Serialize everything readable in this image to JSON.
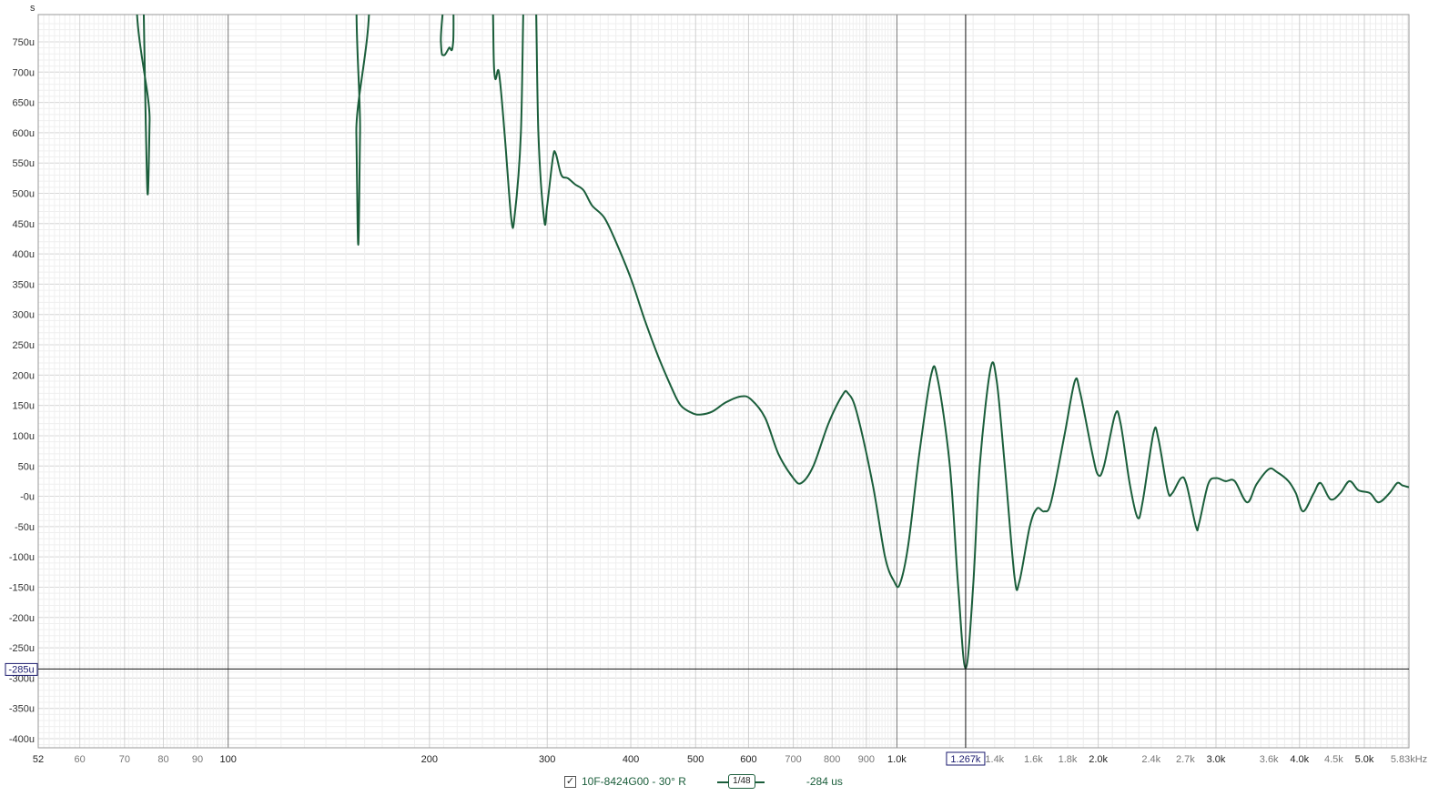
{
  "chart_data": {
    "type": "line",
    "yunit": "s",
    "xunit": "Hz",
    "xscale": "log",
    "xlim": [
      52,
      5830
    ],
    "ylim": [
      -0.000415,
      0.000795
    ],
    "y_ticks": [
      {
        "v": 0.00075,
        "label": "750u"
      },
      {
        "v": 0.0007,
        "label": "700u"
      },
      {
        "v": 0.00065,
        "label": "650u"
      },
      {
        "v": 0.0006,
        "label": "600u"
      },
      {
        "v": 0.00055,
        "label": "550u"
      },
      {
        "v": 0.0005,
        "label": "500u"
      },
      {
        "v": 0.00045,
        "label": "450u"
      },
      {
        "v": 0.0004,
        "label": "400u"
      },
      {
        "v": 0.00035,
        "label": "350u"
      },
      {
        "v": 0.0003,
        "label": "300u"
      },
      {
        "v": 0.00025,
        "label": "250u"
      },
      {
        "v": 0.0002,
        "label": "200u"
      },
      {
        "v": 0.00015,
        "label": "150u"
      },
      {
        "v": 0.0001,
        "label": "100u"
      },
      {
        "v": 5e-05,
        "label": "50u"
      },
      {
        "v": 0,
        "label": "-0u"
      },
      {
        "v": -5e-05,
        "label": "-50u"
      },
      {
        "v": -0.0001,
        "label": "-100u"
      },
      {
        "v": -0.00015,
        "label": "-150u"
      },
      {
        "v": -0.0002,
        "label": "-200u"
      },
      {
        "v": -0.00025,
        "label": "-250u"
      },
      {
        "v": -0.0003,
        "label": "-300u"
      },
      {
        "v": -0.00035,
        "label": "-350u"
      },
      {
        "v": -0.0004,
        "label": "-400u"
      }
    ],
    "x_ticks": [
      {
        "v": 52,
        "label": "52"
      },
      {
        "v": 60,
        "label": "60"
      },
      {
        "v": 70,
        "label": "70"
      },
      {
        "v": 80,
        "label": "80"
      },
      {
        "v": 90,
        "label": "90"
      },
      {
        "v": 100,
        "label": "100"
      },
      {
        "v": 200,
        "label": "200"
      },
      {
        "v": 300,
        "label": "300"
      },
      {
        "v": 400,
        "label": "400"
      },
      {
        "v": 500,
        "label": "500"
      },
      {
        "v": 600,
        "label": "600"
      },
      {
        "v": 700,
        "label": "700"
      },
      {
        "v": 800,
        "label": "800"
      },
      {
        "v": 900,
        "label": "900"
      },
      {
        "v": 1000,
        "label": "1.0k"
      },
      {
        "v": 1400,
        "label": "1.4k"
      },
      {
        "v": 1600,
        "label": "1.6k"
      },
      {
        "v": 1800,
        "label": "1.8k"
      },
      {
        "v": 2000,
        "label": "2.0k"
      },
      {
        "v": 2400,
        "label": "2.4k"
      },
      {
        "v": 2700,
        "label": "2.7k"
      },
      {
        "v": 3000,
        "label": "3.0k"
      },
      {
        "v": 3600,
        "label": "3.6k"
      },
      {
        "v": 4000,
        "label": "4.0k"
      },
      {
        "v": 4500,
        "label": "4.5k"
      },
      {
        "v": 5000,
        "label": "5.0k"
      },
      {
        "v": 5830,
        "label": "5.83kHz"
      }
    ],
    "cursor": {
      "x": 1267,
      "x_label": "1.267k",
      "y": -0.000285,
      "y_label": "-285u"
    },
    "series": [
      {
        "name": "10F-8424G00 - 30° R",
        "color": "#1b5e3b",
        "points": [
          [
            74.5,
            0.0009
          ],
          [
            75.3,
            0.00062
          ],
          [
            75.8,
            0.000498
          ],
          [
            76.3,
            0.00062
          ],
          [
            77.0,
            0.0009
          ],
          [
            154,
            0.0009
          ],
          [
            155.5,
            0.0006
          ],
          [
            156.5,
            0.000415
          ],
          [
            157.5,
            0.0006
          ],
          [
            159,
            0.0009
          ],
          [
            206,
            0.0009
          ],
          [
            208,
            0.00075
          ],
          [
            210,
            0.000728
          ],
          [
            214,
            0.00074
          ],
          [
            217,
            0.00075
          ],
          [
            220,
            0.0009
          ],
          [
            245,
            0.0009
          ],
          [
            250,
            0.0007
          ],
          [
            254,
            0.0007
          ],
          [
            259,
            0.0006
          ],
          [
            265,
            0.00046
          ],
          [
            268,
            0.00046
          ],
          [
            274,
            0.0006
          ],
          [
            278,
            0.0009
          ],
          [
            287,
            0.0009
          ],
          [
            291,
            0.0006
          ],
          [
            297,
            0.000455
          ],
          [
            300,
            0.00048
          ],
          [
            306,
            0.00056
          ],
          [
            309,
            0.000565
          ],
          [
            315,
            0.00053
          ],
          [
            322,
            0.000525
          ],
          [
            330,
            0.000515
          ],
          [
            340,
            0.000505
          ],
          [
            350,
            0.00048
          ],
          [
            365,
            0.00046
          ],
          [
            380,
            0.00042
          ],
          [
            400,
            0.00036
          ],
          [
            420,
            0.00029
          ],
          [
            440,
            0.00023
          ],
          [
            460,
            0.00018
          ],
          [
            475,
            0.00015
          ],
          [
            495,
            0.000137
          ],
          [
            510,
            0.000135
          ],
          [
            530,
            0.00014
          ],
          [
            555,
            0.000155
          ],
          [
            585,
            0.000165
          ],
          [
            605,
            0.00016
          ],
          [
            635,
            0.00013
          ],
          [
            665,
            7e-05
          ],
          [
            700,
            3e-05
          ],
          [
            720,
            2.2e-05
          ],
          [
            750,
            5e-05
          ],
          [
            790,
            0.00012
          ],
          [
            830,
            0.000168
          ],
          [
            845,
            0.00017
          ],
          [
            870,
            0.00014
          ],
          [
            920,
            2e-05
          ],
          [
            960,
            -0.0001
          ],
          [
            990,
            -0.00014
          ],
          [
            1010,
            -0.000145
          ],
          [
            1040,
            -8e-05
          ],
          [
            1080,
            7e-05
          ],
          [
            1125,
            0.0002
          ],
          [
            1150,
            0.000195
          ],
          [
            1200,
            5e-05
          ],
          [
            1235,
            -0.00015
          ],
          [
            1267,
            -0.000284
          ],
          [
            1300,
            -0.00015
          ],
          [
            1330,
            5e-05
          ],
          [
            1380,
            0.00021
          ],
          [
            1410,
            0.00019
          ],
          [
            1450,
            5e-05
          ],
          [
            1500,
            -0.000135
          ],
          [
            1525,
            -0.00014
          ],
          [
            1580,
            -5e-05
          ],
          [
            1620,
            -2e-05
          ],
          [
            1660,
            -2.5e-05
          ],
          [
            1700,
            -1e-05
          ],
          [
            1780,
            0.0001
          ],
          [
            1845,
            0.00019
          ],
          [
            1880,
            0.00017
          ],
          [
            1960,
            7e-05
          ],
          [
            2000,
            3.5e-05
          ],
          [
            2040,
            5e-05
          ],
          [
            2120,
            0.000135
          ],
          [
            2160,
            0.00012
          ],
          [
            2230,
            2e-05
          ],
          [
            2290,
            -3.5e-05
          ],
          [
            2330,
            -1e-05
          ],
          [
            2420,
            0.000105
          ],
          [
            2460,
            9.5e-05
          ],
          [
            2540,
            1e-05
          ],
          [
            2580,
            5e-06
          ],
          [
            2660,
            3e-05
          ],
          [
            2710,
            2e-05
          ],
          [
            2800,
            -5e-05
          ],
          [
            2830,
            -4.5e-05
          ],
          [
            2920,
            2e-05
          ],
          [
            3000,
            3e-05
          ],
          [
            3100,
            2.5e-05
          ],
          [
            3200,
            2.5e-05
          ],
          [
            3340,
            -1e-05
          ],
          [
            3450,
            2e-05
          ],
          [
            3600,
            4.5e-05
          ],
          [
            3700,
            4e-05
          ],
          [
            3850,
            2.5e-05
          ],
          [
            3950,
            5e-06
          ],
          [
            4050,
            -2.5e-05
          ],
          [
            4200,
            5e-06
          ],
          [
            4300,
            2.2e-05
          ],
          [
            4450,
            -5e-06
          ],
          [
            4600,
            5e-06
          ],
          [
            4750,
            2.5e-05
          ],
          [
            4900,
            1e-05
          ],
          [
            5100,
            5e-06
          ],
          [
            5250,
            -1e-05
          ],
          [
            5450,
            5e-06
          ],
          [
            5600,
            2.2e-05
          ],
          [
            5700,
            1.8e-05
          ],
          [
            5830,
            1.5e-05
          ]
        ]
      }
    ]
  },
  "legend": {
    "checkbox_mark": "✓",
    "series_label": "10F-8424G00 - 30° R",
    "smoothing_label": "1/48",
    "value_label": "-284 us"
  }
}
